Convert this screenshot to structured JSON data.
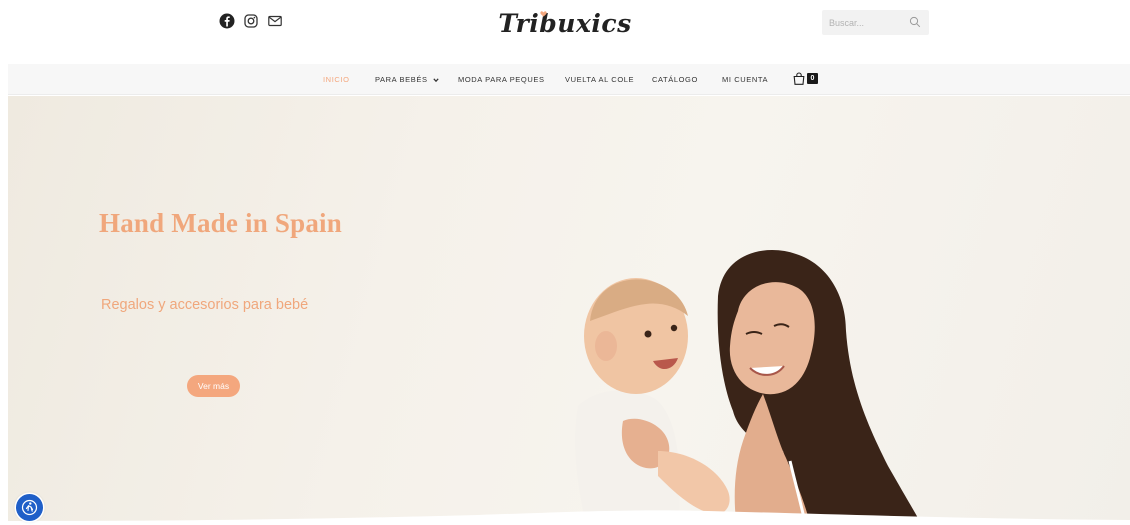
{
  "header": {
    "logo_text": "Tribuxics",
    "social": [
      {
        "icon": "facebook-icon"
      },
      {
        "icon": "instagram-icon"
      },
      {
        "icon": "mail-icon"
      }
    ],
    "search": {
      "placeholder": "Buscar..."
    }
  },
  "nav": {
    "items": [
      {
        "label": "INICIO",
        "active": true
      },
      {
        "label": "PARA BEBÉS",
        "has_dropdown": true
      },
      {
        "label": "MODA PARA PEQUES"
      },
      {
        "label": "VUELTA AL COLE"
      },
      {
        "label": "CATÁLOGO"
      },
      {
        "label": "MI CUENTA"
      }
    ],
    "cart_count": "0"
  },
  "hero": {
    "title": "Hand Made in Spain",
    "subtitle": "Regalos y accesorios para bebé",
    "button_label": "Ver más"
  },
  "colors": {
    "accent": "#f4a77e",
    "nav_background": "#f7f7f7",
    "accessibility_button": "#1f5fc8"
  }
}
